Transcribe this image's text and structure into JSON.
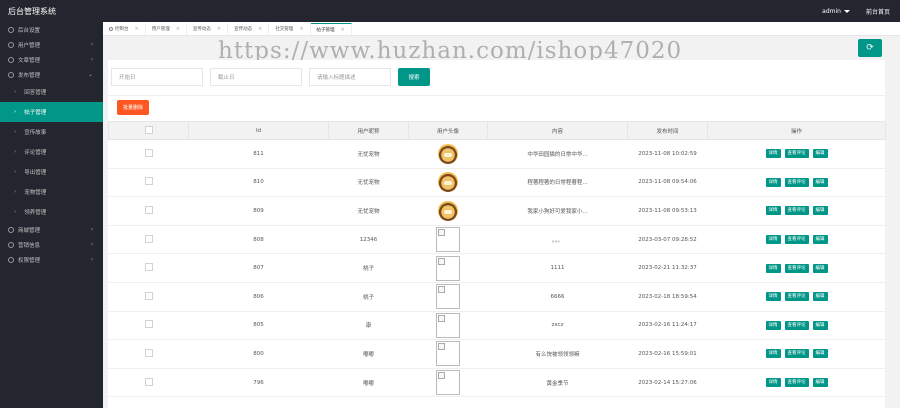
{
  "app": {
    "title": "后台管理系统",
    "user": "admin",
    "home_link": "前台首页"
  },
  "sidebar": {
    "groups": [
      {
        "label": "后台设置",
        "arrow": ""
      },
      {
        "label": "用户管理",
        "arrow": "‹"
      },
      {
        "label": "文章管理",
        "arrow": "‹"
      },
      {
        "label": "发布管理",
        "arrow": "⌄"
      }
    ],
    "subs": [
      {
        "label": "回答管理"
      },
      {
        "label": "帖子管理"
      },
      {
        "label": "宣传故事"
      },
      {
        "label": "评论管理"
      },
      {
        "label": "导出管理"
      },
      {
        "label": "宠物管理"
      },
      {
        "label": "领养管理"
      }
    ],
    "bottom": [
      {
        "label": "商城管理",
        "arrow": "‹"
      },
      {
        "label": "营销信息",
        "arrow": "‹"
      },
      {
        "label": "权限管理",
        "arrow": "‹"
      }
    ]
  },
  "tabs": [
    {
      "label": "控制台"
    },
    {
      "label": "用户管理"
    },
    {
      "label": "宣传动态"
    },
    {
      "label": "宣传动态"
    },
    {
      "label": "社交管理"
    },
    {
      "label": "帖子管理"
    }
  ],
  "watermark": "https://www.huzhan.com/ishop47020",
  "filters": {
    "start_placeholder": "开始日",
    "end_placeholder": "截止日",
    "keyword_placeholder": "请输入标题描述",
    "search_label": "搜索"
  },
  "bulk_delete_label": "批量删除",
  "table": {
    "headers": [
      "",
      "Id",
      "用户昵称",
      "用户头像",
      "内容",
      "发布时间",
      "操作"
    ],
    "rows": [
      {
        "id": "811",
        "nickname": "无忧宠物",
        "avatar": "cartoon",
        "content": "中华田园猫的日常中华...",
        "time": "2023-11-08 10:02:59"
      },
      {
        "id": "810",
        "nickname": "无忧宠物",
        "avatar": "cartoon",
        "content": "程著程著的日常程著程...",
        "time": "2023-11-08 09:54:06"
      },
      {
        "id": "809",
        "nickname": "无忧宠物",
        "avatar": "cartoon",
        "content": "我家小狗好可爱我家小...",
        "time": "2023-11-08 09:53:13"
      },
      {
        "id": "808",
        "nickname": "12346",
        "avatar": "broken",
        "content": "。。。",
        "time": "2023-03-07 09:28:52"
      },
      {
        "id": "807",
        "nickname": "桃子",
        "avatar": "broken",
        "content": "1111",
        "time": "2023-02-21 11:32:37"
      },
      {
        "id": "806",
        "nickname": "桃子",
        "avatar": "broken",
        "content": "6666",
        "time": "2023-02-18 18:59:54"
      },
      {
        "id": "805",
        "nickname": "康",
        "avatar": "broken",
        "content": "zxcz",
        "time": "2023-02-16 11:24:17"
      },
      {
        "id": "800",
        "nickname": "嘟嘟",
        "avatar": "broken",
        "content": "有么快被领领领嘛",
        "time": "2023-02-16 15:59:01"
      },
      {
        "id": "796",
        "nickname": "嘟嘟",
        "avatar": "broken",
        "content": "黄金季节",
        "time": "2023-02-14 15:27:06"
      }
    ],
    "actions": [
      "详情",
      "查看评论",
      "编辑"
    ]
  },
  "colors": {
    "accent": "#009688",
    "danger": "#ff5722",
    "dark": "#23262e"
  }
}
